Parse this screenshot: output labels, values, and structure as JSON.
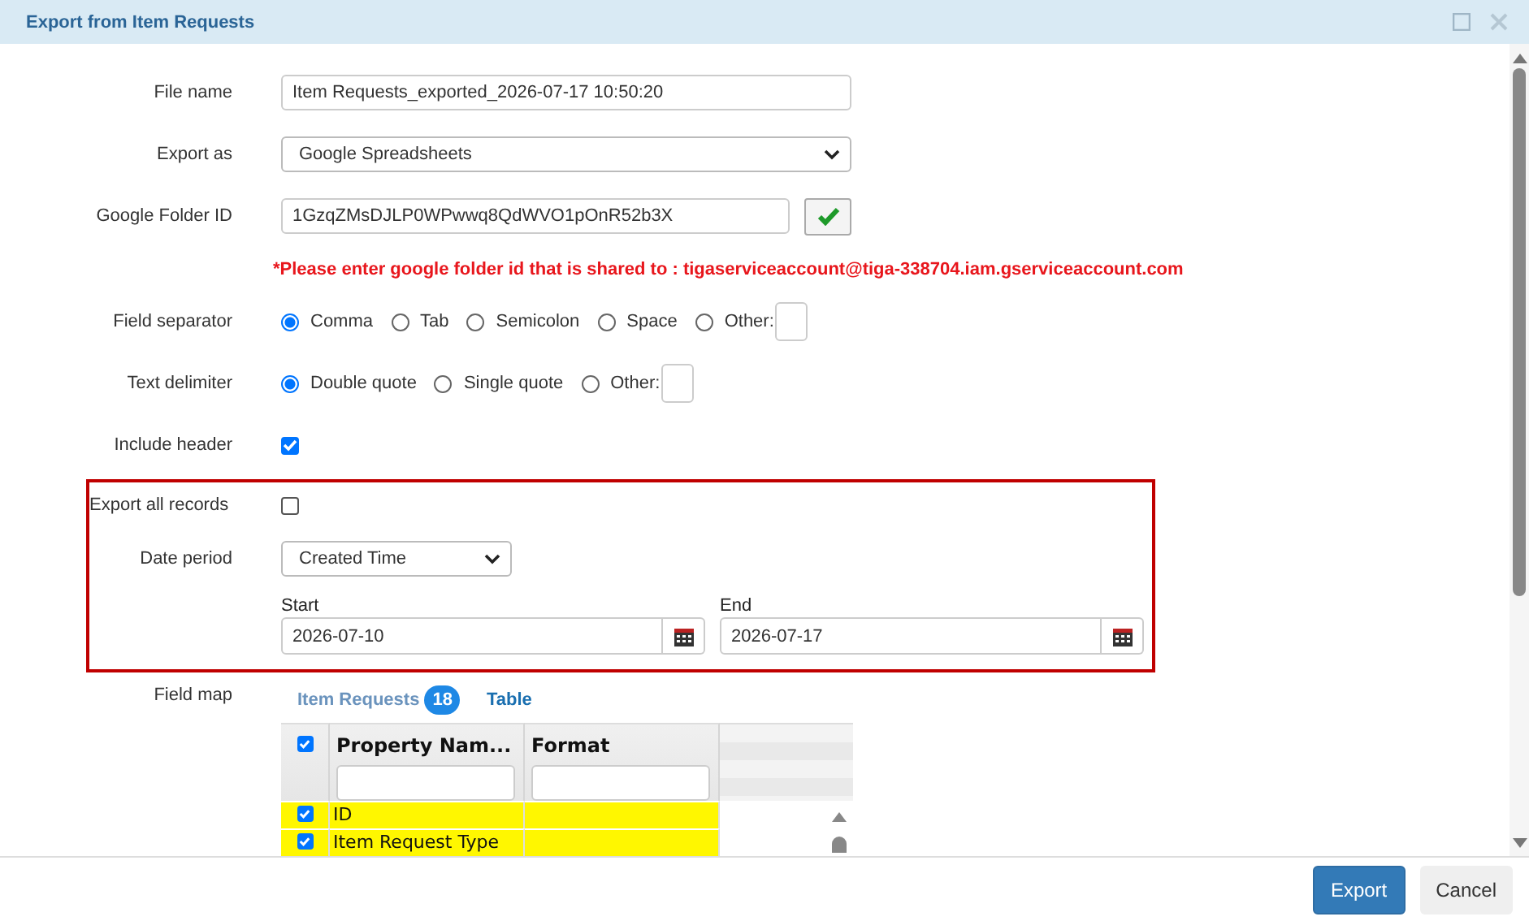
{
  "window": {
    "title": "Export from Item Requests"
  },
  "form": {
    "file_name": {
      "label": "File name",
      "value": "Item Requests_exported_2026-07-17 10:50:20"
    },
    "export_as": {
      "label": "Export as",
      "value": "Google Spreadsheets"
    },
    "google_folder_id": {
      "label": "Google Folder ID",
      "value": "1GzqZMsDJLP0WPwwq8QdWVO1pOnR52b3X"
    },
    "warning": "*Please enter google folder id that is shared to : tigaserviceaccount@tiga-338704.iam.gserviceaccount.com",
    "field_separator": {
      "label": "Field separator",
      "options": [
        {
          "label": "Comma",
          "kind": "radio",
          "selected": true
        },
        {
          "label": "Tab",
          "kind": "radio",
          "selected": false
        },
        {
          "label": "Semicolon",
          "kind": "radio",
          "selected": false
        },
        {
          "label": "Space",
          "kind": "radio",
          "selected": false
        },
        {
          "label": "Other:",
          "kind": "other",
          "selected": false
        }
      ]
    },
    "text_delimiter": {
      "label": "Text delimiter",
      "options": [
        {
          "label": "Double quote",
          "kind": "radio",
          "selected": true
        },
        {
          "label": "Single quote",
          "kind": "radio",
          "selected": false
        },
        {
          "label": "Other:",
          "kind": "other",
          "selected": false
        }
      ]
    },
    "include_header": {
      "label": "Include header",
      "checked": true
    },
    "export_all_records": {
      "label": "Export all records",
      "checked": false
    },
    "date_period": {
      "label": "Date period",
      "value": "Created Time"
    },
    "start": {
      "label": "Start",
      "value": "2026-07-10"
    },
    "end": {
      "label": "End",
      "value": "2026-07-17"
    },
    "field_map": {
      "label": "Field map",
      "tabs": [
        {
          "label": "Item Requests",
          "badge": "18",
          "selected": true
        },
        {
          "label": "Table",
          "selected": false
        }
      ],
      "all_checked": true,
      "columns": [
        "Property Nam...",
        "Format"
      ],
      "rows": [
        {
          "checked": true,
          "highlighted": true,
          "property": "ID",
          "format": ""
        },
        {
          "checked": true,
          "highlighted": true,
          "property": "Item Request Type",
          "format": ""
        }
      ]
    }
  },
  "buttons": [
    {
      "label": "Export",
      "kind": "primary"
    },
    {
      "label": "Cancel",
      "kind": "default"
    }
  ]
}
